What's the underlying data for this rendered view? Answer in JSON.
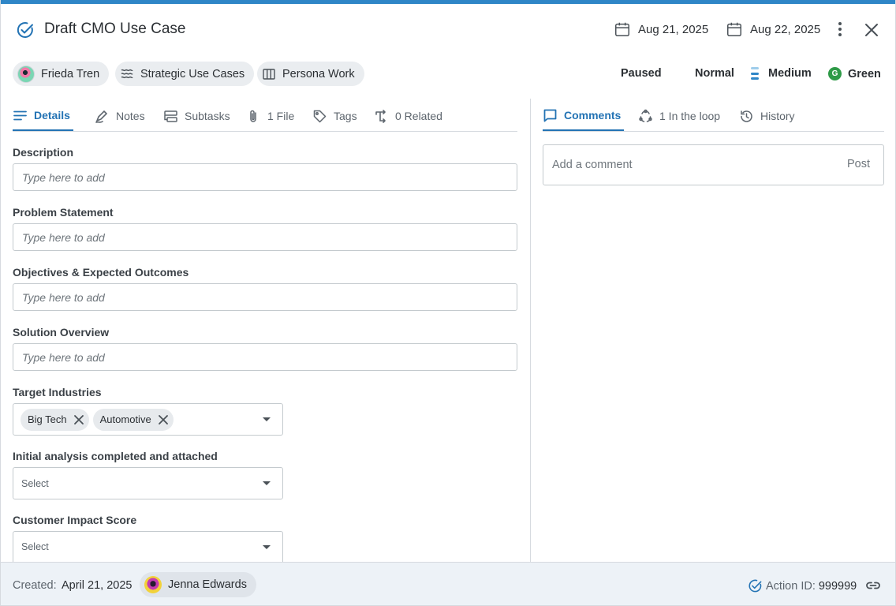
{
  "header": {
    "title": "Draft CMO Use Case",
    "start_date": "Aug 21, 2025",
    "due_date": "Aug 22, 2025"
  },
  "chips": {
    "owner": "Frieda Tren",
    "project": "Strategic Use Cases",
    "board": "Persona Work"
  },
  "properties": {
    "status": "Paused",
    "priority": "Normal",
    "effort": "Medium",
    "health_letter": "G",
    "health": "Green"
  },
  "left_tabs": [
    {
      "label": "Details"
    },
    {
      "label": "Notes"
    },
    {
      "label": "Subtasks"
    },
    {
      "label": "1 File"
    },
    {
      "label": "Tags"
    },
    {
      "label": "0 Related"
    }
  ],
  "right_tabs": [
    {
      "label": "Comments"
    },
    {
      "label": "1 In the loop"
    },
    {
      "label": "History"
    }
  ],
  "form": {
    "description_label": "Description",
    "problem_label": "Problem Statement",
    "objectives_label": "Objectives & Expected Outcomes",
    "solution_label": "Solution Overview",
    "placeholder": "Type here to add",
    "industries_label": "Target Industries",
    "industries": [
      "Big Tech",
      "Automotive"
    ],
    "analysis_label": "Initial analysis completed and attached",
    "impact_label": "Customer Impact Score",
    "select_placeholder": "Select"
  },
  "comments": {
    "placeholder": "Add a comment",
    "post_label": "Post"
  },
  "footer": {
    "created_label": "Created:",
    "created_date": "April 21, 2025",
    "creator": "Jenna Edwards",
    "action_id_label": "Action ID:",
    "action_id": "999999"
  },
  "colors": {
    "accent": "#2373b4",
    "health": "#2e9a47",
    "footer_bg": "#edf2f7"
  }
}
